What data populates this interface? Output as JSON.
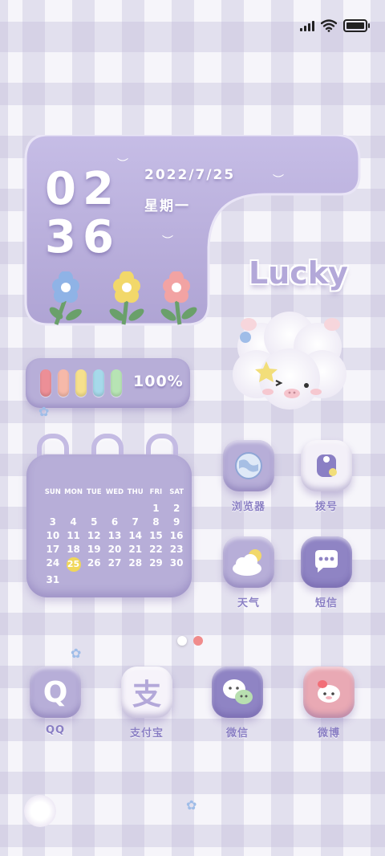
{
  "status_bar": {
    "signal": "signal-icon",
    "wifi": "wifi-icon",
    "battery": "battery-icon"
  },
  "clock_widget": {
    "hours": "02",
    "minutes": "36",
    "date": "2022/7/25",
    "weekday": "星期一"
  },
  "lucky_text": "Lucky",
  "battery_widget": {
    "percent": "100%",
    "level": 1.0,
    "bar_colors": [
      "#ec8f97",
      "#f6b9a9",
      "#f6e08c",
      "#a6d9ea",
      "#b7e4b4"
    ]
  },
  "calendar": {
    "weekdays": [
      "SUN",
      "MON",
      "TUE",
      "WED",
      "THU",
      "FRI",
      "SAT"
    ],
    "days": [
      "",
      "",
      "",
      "",
      "",
      "1",
      "2",
      "3",
      "4",
      "5",
      "6",
      "7",
      "8",
      "9",
      "10",
      "11",
      "12",
      "13",
      "14",
      "15",
      "16",
      "17",
      "18",
      "19",
      "20",
      "21",
      "22",
      "23",
      "24",
      "25",
      "26",
      "27",
      "28",
      "29",
      "30",
      "31",
      "",
      "",
      "",
      "",
      "",
      ""
    ],
    "today": "25"
  },
  "apps_right": [
    {
      "label": "浏览器",
      "icon": "browser-globe-icon"
    },
    {
      "label": "拨号",
      "icon": "phone-icon"
    },
    {
      "label": "天气",
      "icon": "weather-cloud-icon"
    },
    {
      "label": "短信",
      "icon": "message-bubble-icon"
    }
  ],
  "dock": [
    {
      "label": "QQ",
      "icon": "qq-icon"
    },
    {
      "label": "支付宝",
      "icon": "alipay-icon",
      "glyph": "支"
    },
    {
      "label": "微信",
      "icon": "wechat-icon"
    },
    {
      "label": "微博",
      "icon": "weibo-icon"
    }
  ],
  "colors": {
    "accent": "#b7aed8",
    "label": "#8a7fc4",
    "dot_active": "#f08b8b"
  },
  "page_indicator": {
    "pages": 2,
    "active": 2
  }
}
